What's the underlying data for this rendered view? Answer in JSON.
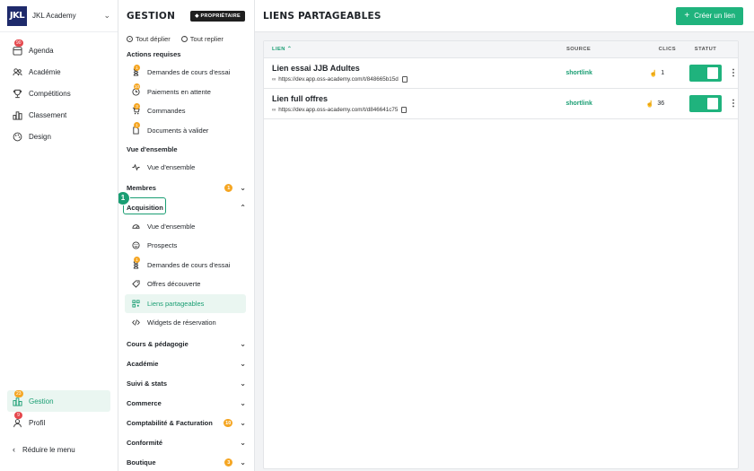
{
  "app": {
    "logo": "JKL",
    "name": "JKL Academy"
  },
  "left_nav": {
    "items": [
      {
        "label": "Agenda",
        "icon": "calendar-icon",
        "badge": "90"
      },
      {
        "label": "Académie",
        "icon": "users-icon"
      },
      {
        "label": "Compétitions",
        "icon": "trophy-icon"
      },
      {
        "label": "Classement",
        "icon": "ranking-icon"
      },
      {
        "label": "Design",
        "icon": "palette-icon"
      }
    ],
    "bottom": [
      {
        "label": "Gestion",
        "icon": "chart-icon",
        "badge": "23",
        "active": true
      },
      {
        "label": "Profil",
        "icon": "person-icon",
        "badge": "9"
      }
    ],
    "reduce_label": "Réduire le menu"
  },
  "middle": {
    "title": "GESTION",
    "owner_badge": "PROPRIÉTAIRE",
    "expand_all": "Tout déplier",
    "collapse_all": "Tout replier",
    "actions": {
      "title": "Actions requises",
      "items": [
        {
          "label": "Demandes de cours d'essai",
          "badge": "1"
        },
        {
          "label": "Paiements en attente",
          "badge": "10"
        },
        {
          "label": "Commandes",
          "badge": "3"
        },
        {
          "label": "Documents à valider",
          "badge": "1"
        }
      ]
    },
    "overview": {
      "title": "Vue d'ensemble",
      "item": "Vue d'ensemble"
    },
    "membres": {
      "label": "Membres",
      "badge": "1"
    },
    "acquisition": {
      "label": "Acquisition",
      "step": "1",
      "items": [
        {
          "label": "Vue d'ensemble"
        },
        {
          "label": "Prospects"
        },
        {
          "label": "Demandes de cours d'essai",
          "badge": "1"
        },
        {
          "label": "Offres découverte"
        },
        {
          "label": "Liens partageables",
          "active": true
        },
        {
          "label": "Widgets de réservation"
        }
      ]
    },
    "sections": [
      {
        "label": "Cours & pédagogie"
      },
      {
        "label": "Académie"
      },
      {
        "label": "Suivi & stats"
      },
      {
        "label": "Commerce"
      },
      {
        "label": "Comptabilité & Facturation",
        "badge": "10"
      },
      {
        "label": "Conformité"
      },
      {
        "label": "Boutique",
        "badge": "3"
      }
    ]
  },
  "main": {
    "title": "LIENS PARTAGEABLES",
    "create_label": "Créer un lien",
    "columns": {
      "lien": "LIEN",
      "source": "SOURCE",
      "clics": "CLICS",
      "statut": "STATUT"
    },
    "rows": [
      {
        "name": "Lien essai JJB Adultes",
        "url": "https://dev.app.oss-academy.com/t/848665b15d",
        "source": "shortlink",
        "clicks": "1",
        "active": true
      },
      {
        "name": "Lien full offres",
        "url": "https://dev.app.oss-academy.com/t/d846641c75",
        "source": "shortlink",
        "clicks": "36",
        "active": true
      }
    ]
  },
  "colors": {
    "accent": "#1fb37d",
    "badge_orange": "#f5a623",
    "badge_red": "#e5484d",
    "logo_bg": "#1e2a6b"
  }
}
